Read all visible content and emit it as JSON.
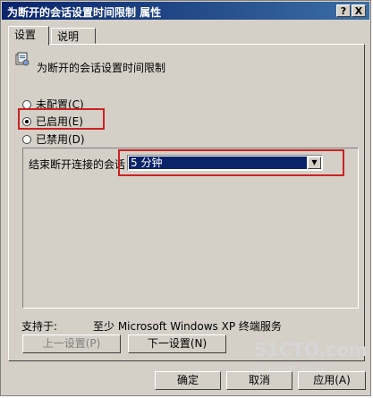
{
  "window": {
    "title": "为断开的会话设置时间限制 属性",
    "help_label": "?",
    "close_label": "X"
  },
  "tabs": [
    {
      "label": "设置"
    },
    {
      "label": "说明"
    }
  ],
  "policy": {
    "title": "为断开的会话设置时间限制",
    "icon": "policy-settings-icon"
  },
  "radios": [
    {
      "label": "未配置(C)",
      "selected": false
    },
    {
      "label": "已启用(E)",
      "selected": true
    },
    {
      "label": "已禁用(D)",
      "selected": false
    }
  ],
  "option": {
    "label": "结束断开连接的会话",
    "value": "5 分钟"
  },
  "support": {
    "label": "支持于:",
    "value": "至少 Microsoft Windows XP 终端服务"
  },
  "buttons": {
    "prev": "上一设置(P)",
    "next": "下一设置(N)",
    "ok": "确定",
    "cancel": "取消",
    "apply": "应用(A)"
  },
  "watermark": {
    "line1": "51CTO.com",
    "line2": "技术博客 Blog"
  },
  "colors": {
    "highlight": "#cc2222",
    "titlebar": "#0a246a",
    "face": "#d4d0c8"
  }
}
